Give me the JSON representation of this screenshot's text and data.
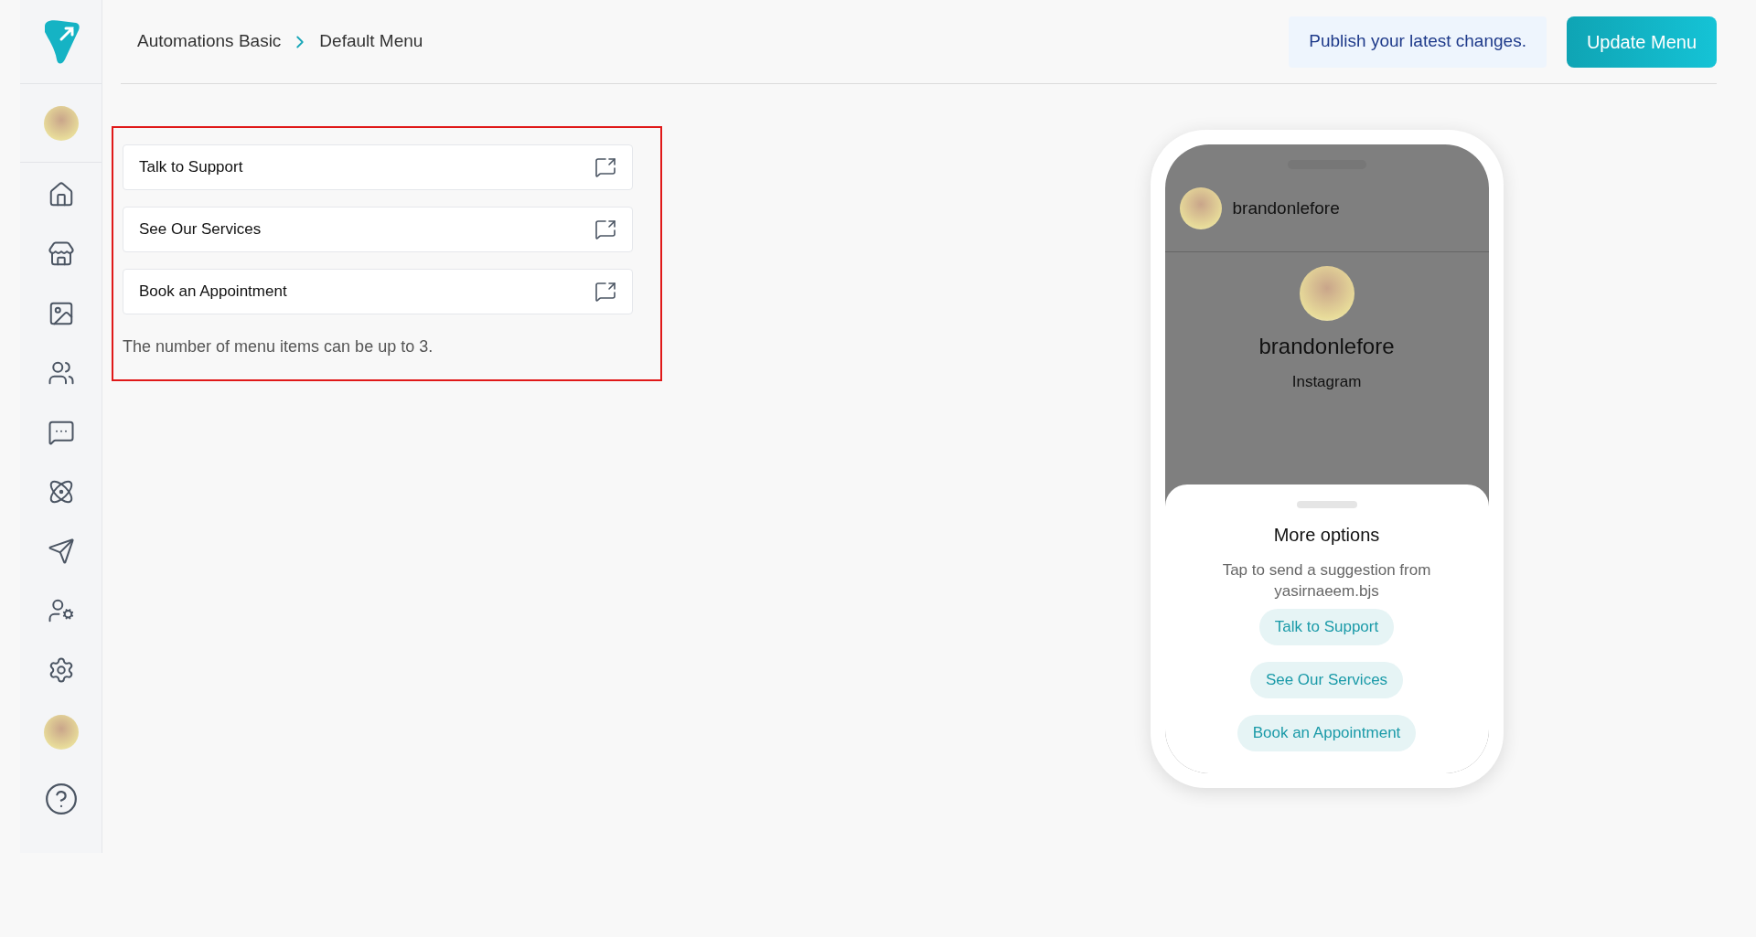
{
  "breadcrumb": [
    "Automations Basic",
    "Default Menu"
  ],
  "publish_note": "Publish your latest changes.",
  "update_button": "Update Menu",
  "menu_items": [
    {
      "label": "Talk to Support"
    },
    {
      "label": "See Our Services"
    },
    {
      "label": "Book an Appointment"
    }
  ],
  "menu_note": "The number of menu items can be up to 3.",
  "preview": {
    "header_username": "brandonlefore",
    "profile_name": "brandonlefore",
    "profile_platform": "Instagram",
    "sheet_title": "More options",
    "sheet_subtitle": "Tap to send a suggestion from yasirnaeem.bjs",
    "suggestions": [
      "Talk to Support",
      "See Our Services",
      "Book an Appointment"
    ]
  }
}
